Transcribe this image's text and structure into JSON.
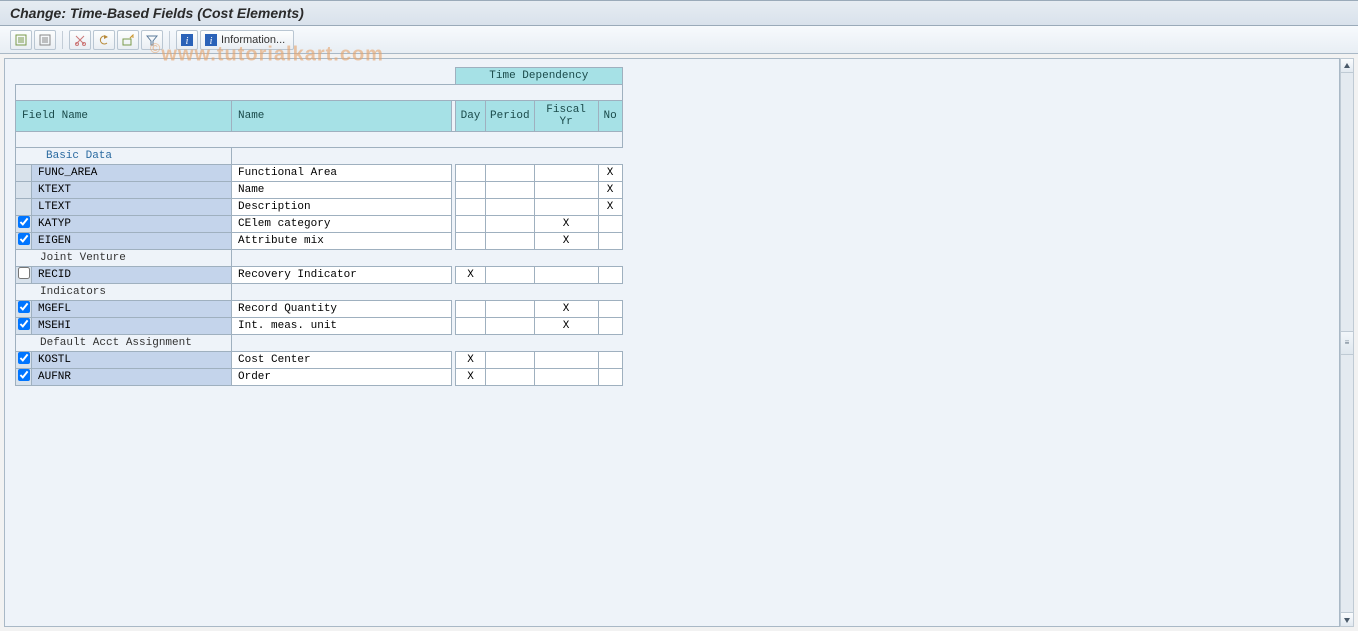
{
  "title": "Change: Time-Based Fields (Cost Elements)",
  "watermark": "www.tutorialkart.com",
  "toolbar": {
    "info_label": "Information..."
  },
  "headers": {
    "field_name": "Field Name",
    "name": "Name",
    "time_dependency": "Time Dependency",
    "day": "Day",
    "period": "Period",
    "fiscal_yr": "Fiscal Yr",
    "no": "No"
  },
  "sections": [
    {
      "label": "Basic Data",
      "label_style": "blue",
      "rows": [
        {
          "checkbox": null,
          "field": "FUNC_AREA",
          "name": "Functional Area",
          "day": "",
          "period": "",
          "fiscal": "",
          "no": "X"
        },
        {
          "checkbox": null,
          "field": "KTEXT",
          "name": "Name",
          "day": "",
          "period": "",
          "fiscal": "",
          "no": "X"
        },
        {
          "checkbox": null,
          "field": "LTEXT",
          "name": "Description",
          "day": "",
          "period": "",
          "fiscal": "",
          "no": "X"
        },
        {
          "checkbox": true,
          "field": "KATYP",
          "name": "CElem category",
          "day": "",
          "period": "",
          "fiscal": "X",
          "no": ""
        },
        {
          "checkbox": true,
          "field": "EIGEN",
          "name": "Attribute mix",
          "day": "",
          "period": "",
          "fiscal": "X",
          "no": ""
        }
      ]
    },
    {
      "label": "Joint Venture",
      "label_style": "dark",
      "rows": [
        {
          "checkbox": false,
          "field": "RECID",
          "name": "Recovery Indicator",
          "day": "X",
          "period": "",
          "fiscal": "",
          "no": ""
        }
      ]
    },
    {
      "label": "Indicators",
      "label_style": "dark",
      "rows": [
        {
          "checkbox": true,
          "field": "MGEFL",
          "name": "Record Quantity",
          "day": "",
          "period": "",
          "fiscal": "X",
          "no": ""
        },
        {
          "checkbox": true,
          "field": "MSEHI",
          "name": "Int. meas. unit",
          "day": "",
          "period": "",
          "fiscal": "X",
          "no": ""
        }
      ]
    },
    {
      "label": "Default Acct Assignment",
      "label_style": "dark",
      "rows": [
        {
          "checkbox": true,
          "field": "KOSTL",
          "name": "Cost Center",
          "day": "X",
          "period": "",
          "fiscal": "",
          "no": ""
        },
        {
          "checkbox": true,
          "field": "AUFNR",
          "name": "Order",
          "day": "X",
          "period": "",
          "fiscal": "",
          "no": ""
        }
      ]
    }
  ]
}
